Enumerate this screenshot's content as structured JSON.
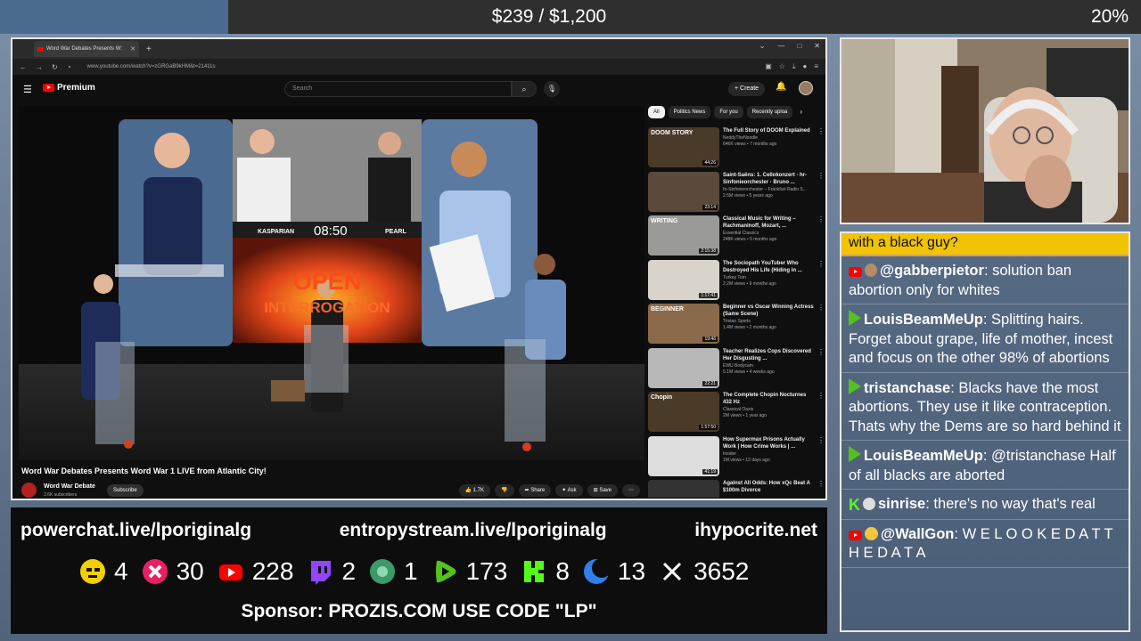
{
  "goal": {
    "text": "$239 / $1,200",
    "percent": "20%",
    "fraction": 0.2
  },
  "browser": {
    "tab_title": "Word War Debates Presents W:",
    "url": "www.youtube.com/watch?v=zGRGaB9kHM&t=21411s",
    "youtube": {
      "logo_label": "Premium",
      "search_placeholder": "Search",
      "create_label": "Create",
      "video_title": "Word War Debates Presents Word War 1 LIVE from Atlantic City!",
      "channel_name": "Word War Debate",
      "channel_subs": "2.6K subscribers",
      "subscribe_label": "Subscribe",
      "actions": {
        "like": "1.7K",
        "share": "Share",
        "ask": "Ask",
        "save": "Save"
      },
      "stage": {
        "left_name": "KASPARIAN",
        "timer": "08:50",
        "right_name": "PEARL",
        "banner_line1": "OPEN",
        "banner_line2": "INTERROGATION"
      },
      "chips": [
        "All",
        "Politics News",
        "For you",
        "Recently uploa"
      ],
      "recommendations": [
        {
          "title": "The Full Story of DOOM Explained",
          "channel": "NeddyTheNoodle",
          "meta": "646K views • 7 months ago",
          "duration": "44:26",
          "thumb_text": "DOOM STORY",
          "color": "#4a3a2a"
        },
        {
          "title": "Saint-Saëns: 1. Cellokonzert · hr-Sinfonieorchester · Bruno ...",
          "channel": "hr-Sinfonieorchester – Frankfurt Radio S...",
          "meta": "2.5M views • 5 years ago",
          "duration": "23:14",
          "thumb_text": "",
          "color": "#5a4a3c"
        },
        {
          "title": "Classical Music for Writing – Rachmaninoff, Mozart, ...",
          "channel": "Essential Classics",
          "meta": "248K views • 5 months ago",
          "duration": "2:15:38",
          "thumb_text": "WRITING",
          "color": "#9a9a96"
        },
        {
          "title": "The Sociopath YouTuber Who Destroyed His Life (Hiding in ...",
          "channel": "Turkey Tom",
          "meta": "2.2M views • 9 months ago",
          "duration": "1:17:41",
          "thumb_text": "",
          "color": "#d8d4cc"
        },
        {
          "title": "Beginner vs Oscar Winning Actress (Same Scene)",
          "channel": "Tristan Sports",
          "meta": "1.4M views • 2 months ago",
          "duration": "19:46",
          "thumb_text": "BEGINNER",
          "color": "#8a6a4a"
        },
        {
          "title": "Teacher Realizes Cops Discovered Her Disgusting ...",
          "channel": "EWU Bodycam",
          "meta": "5.1M views • 4 weeks ago",
          "duration": "22:21",
          "thumb_text": "",
          "color": "#b8b8b8"
        },
        {
          "title": "The Complete Chopin Nocturnes 432 Hz",
          "channel": "Classical Oasis",
          "meta": "2M views • 1 year ago",
          "duration": "1:57:50",
          "thumb_text": "Chopin",
          "color": "#4a3a28"
        },
        {
          "title": "How Supermax Prisons Actually Work | How Crime Works | ...",
          "channel": "Insider",
          "meta": "1M views • 12 days ago",
          "duration": "41:19",
          "thumb_text": "",
          "color": "#ddd"
        },
        {
          "title": "Against All Odds: How xQc Beat A $100m Divorce",
          "channel": "",
          "meta": "",
          "duration": "",
          "thumb_text": "",
          "color": "#333"
        }
      ]
    }
  },
  "chat": {
    "header": "with a black guy?",
    "messages": [
      {
        "icons": [
          "yt",
          "dude"
        ],
        "user": "@gabberpietor",
        "text": "solution ban abortion only for whites",
        "color": "#ffffff"
      },
      {
        "icons": [
          "rm"
        ],
        "user": "LouisBeamMeUp",
        "text": "Splitting hairs. Forget about grape, life of mother, incest and focus on the other 98% of abortions",
        "color": "#ffffff"
      },
      {
        "icons": [
          "rm"
        ],
        "user": "tristanchase",
        "text": "Blacks have the most abortions. They use it like contraception. Thats why the Dems are so hard behind it",
        "color": "#ffffff"
      },
      {
        "icons": [
          "rm"
        ],
        "user": "LouisBeamMeUp",
        "text": "@tristanchase Half of all blacks are aborted",
        "color": "#ffffff"
      },
      {
        "icons": [
          "k",
          "skull"
        ],
        "user": "sinrise",
        "text": "there's no way that's real",
        "color": "#ffffff"
      },
      {
        "icons": [
          "yt",
          "face"
        ],
        "user": "@WallGon",
        "text": "W E L O O K E D A T T H E D A T A",
        "color": "#ffffff"
      }
    ]
  },
  "bottom": {
    "links": [
      "powerchat.live/lporiginalg",
      "entropystream.live/lporiginalg",
      "ihypocrite.net"
    ],
    "stats": [
      {
        "icon": "rumble-face-icon",
        "value": "4",
        "color": "#f5d000"
      },
      {
        "icon": "dlive-icon",
        "value": "30",
        "color": "#e91e63"
      },
      {
        "icon": "youtube-icon",
        "value": "228",
        "color": "#ff0000"
      },
      {
        "icon": "twitch-icon",
        "value": "2",
        "color": "#9146ff"
      },
      {
        "icon": "globe-icon",
        "value": "1",
        "color": "#3c9a6a"
      },
      {
        "icon": "rumble-icon",
        "value": "173",
        "color": "#53c21e"
      },
      {
        "icon": "kick-icon",
        "value": "8",
        "color": "#53fc18"
      },
      {
        "icon": "moon-icon",
        "value": "13",
        "color": "#2f80ed"
      },
      {
        "icon": "x-icon",
        "value": "3652",
        "color": "#ffffff"
      }
    ],
    "sponsor": "Sponsor: PROZIS.COM USE CODE \"LP\""
  }
}
